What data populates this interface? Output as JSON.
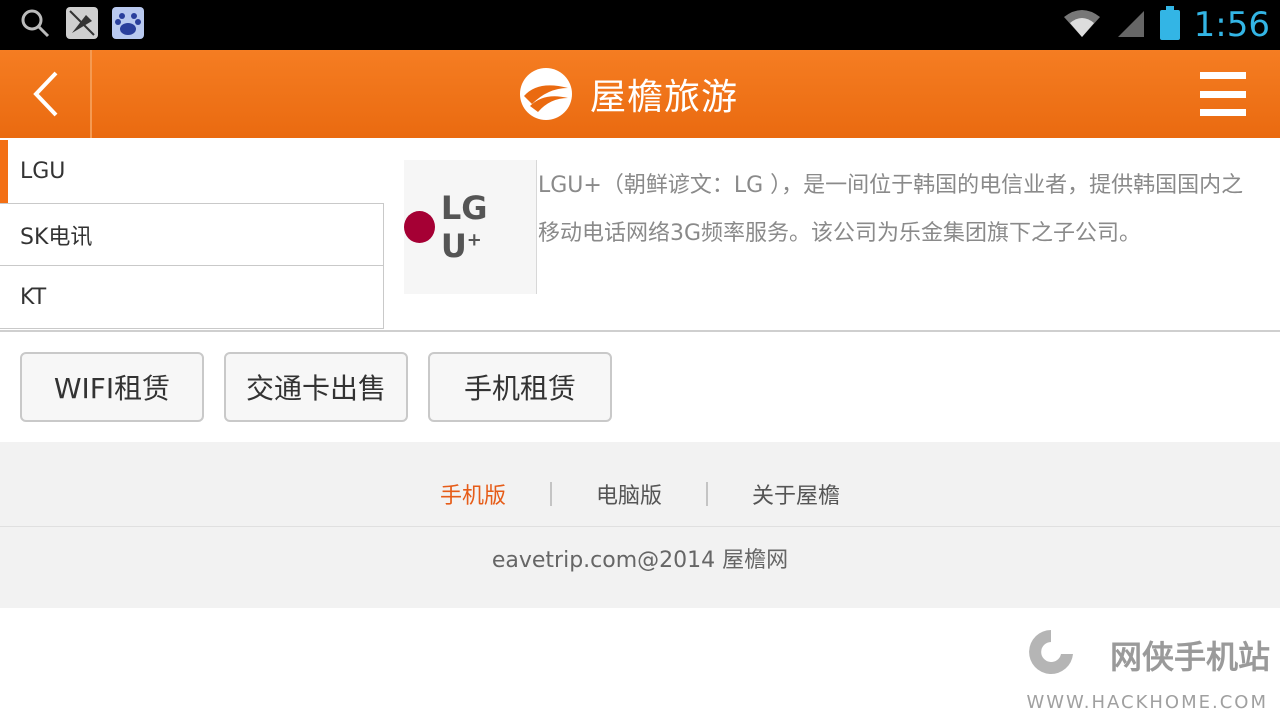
{
  "statusbar": {
    "time": "1:56",
    "icons": [
      "search-icon",
      "silent-notification-icon",
      "baidu-icon",
      "wifi-icon",
      "cell-signal-icon",
      "battery-icon"
    ]
  },
  "header": {
    "title": "屋檐旅游",
    "back_icon": "chevron-left-icon",
    "menu_icon": "hamburger-menu-icon",
    "accent": "#f36f14"
  },
  "carriers": {
    "items": [
      {
        "label": "LGU",
        "selected": true
      },
      {
        "label": "SK电讯",
        "selected": false
      },
      {
        "label": "KT",
        "selected": false
      }
    ]
  },
  "detail": {
    "logo_text": "LG U",
    "logo_sup": "+",
    "description": "LGU+（朝鲜谚文：LG    ），是一间位于韩国的电信业者，提供韩国国内之移动电话网络3G频率服务。该公司为乐金集团旗下之子公司。"
  },
  "services": {
    "buttons": [
      "WIFI租赁",
      "交通卡出售",
      "手机租赁"
    ]
  },
  "footer": {
    "links": [
      "手机版",
      "电脑版",
      "关于屋檐"
    ],
    "active_link": "手机版",
    "copyright": "eavetrip.com@2014 屋檐网"
  },
  "watermark": {
    "title": "网侠手机站",
    "url": "WWW.HACKHOME.COM"
  }
}
